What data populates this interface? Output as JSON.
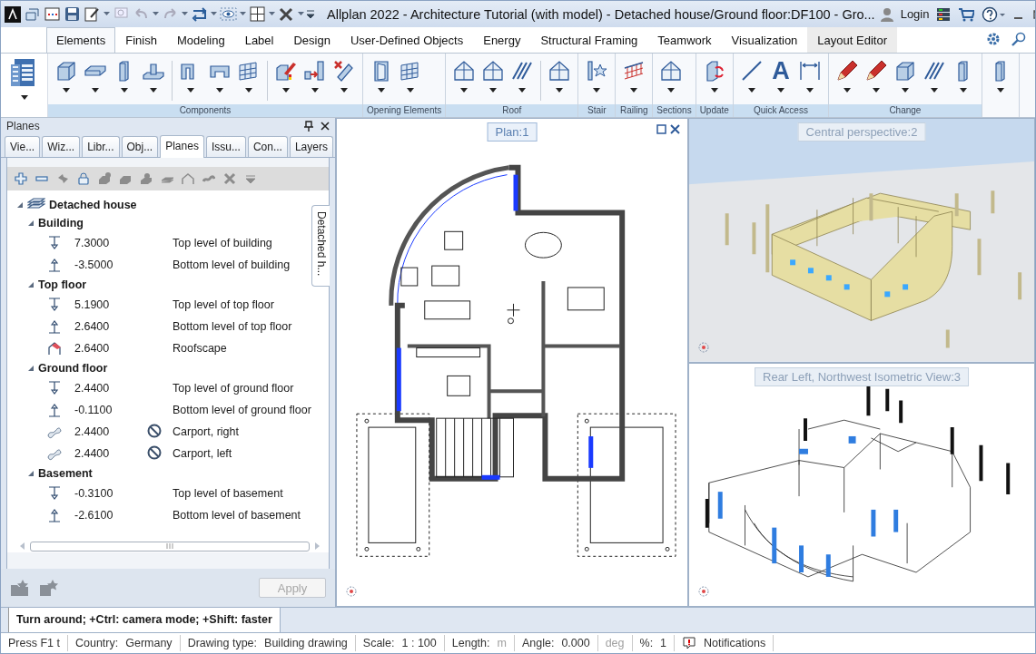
{
  "title_bar": {
    "title": "Allplan 2022 - Architecture Tutorial (with model) - Detached house/Ground floor:DF100 - Gro...",
    "login": "Login"
  },
  "ribbon": {
    "tabs": [
      {
        "label": "Elements",
        "selected": true,
        "contextual": false
      },
      {
        "label": "Finish",
        "selected": false,
        "contextual": false
      },
      {
        "label": "Modeling",
        "selected": false,
        "contextual": false
      },
      {
        "label": "Label",
        "selected": false,
        "contextual": false
      },
      {
        "label": "Design",
        "selected": false,
        "contextual": false
      },
      {
        "label": "User-Defined Objects",
        "selected": false,
        "contextual": false
      },
      {
        "label": "Energy",
        "selected": false,
        "contextual": false
      },
      {
        "label": "Structural Framing",
        "selected": false,
        "contextual": false
      },
      {
        "label": "Teamwork",
        "selected": false,
        "contextual": false
      },
      {
        "label": "Visualization",
        "selected": false,
        "contextual": false
      },
      {
        "label": "Layout Editor",
        "selected": false,
        "contextual": true
      }
    ],
    "groups": [
      {
        "label": "Components",
        "tools": [
          {
            "kind": "block"
          },
          {
            "kind": "slab"
          },
          {
            "kind": "pillar"
          },
          {
            "kind": "footing"
          },
          {
            "kind": "separator"
          },
          {
            "kind": "frame"
          },
          {
            "kind": "channel"
          },
          {
            "kind": "grid"
          },
          {
            "kind": "separator"
          },
          {
            "kind": "pencil-block"
          },
          {
            "kind": "arrow"
          },
          {
            "kind": "cross"
          }
        ]
      },
      {
        "label": "Opening Elements",
        "tools": [
          {
            "kind": "door"
          },
          {
            "kind": "grid"
          }
        ]
      },
      {
        "label": "Roof",
        "tools": [
          {
            "kind": "house"
          },
          {
            "kind": "house"
          },
          {
            "kind": "hatch"
          },
          {
            "kind": "separator"
          },
          {
            "kind": "house"
          }
        ]
      },
      {
        "label": "Stair",
        "tools": [
          {
            "kind": "star"
          }
        ]
      },
      {
        "label": "Railing",
        "tools": [
          {
            "kind": "railing"
          }
        ]
      },
      {
        "label": "Sections",
        "tools": [
          {
            "kind": "house"
          }
        ]
      },
      {
        "label": "Update",
        "tools": [
          {
            "kind": "refresh"
          }
        ]
      },
      {
        "label": "Quick Access",
        "tools": [
          {
            "kind": "line"
          },
          {
            "kind": "glyph",
            "glyph": "A"
          },
          {
            "kind": "dimension"
          }
        ]
      },
      {
        "label": "Change",
        "tools": [
          {
            "kind": "pencil"
          },
          {
            "kind": "pencil"
          },
          {
            "kind": "block"
          },
          {
            "kind": "hatch"
          },
          {
            "kind": "pillar"
          }
        ]
      },
      {
        "tools": [
          {
            "kind": "pillar"
          }
        ]
      }
    ]
  },
  "planes_panel": {
    "title": "Planes",
    "tabs": [
      {
        "label": "Vie...",
        "selected": false
      },
      {
        "label": "Wiz...",
        "selected": false
      },
      {
        "label": "Libr...",
        "selected": false
      },
      {
        "label": "Obj...",
        "selected": false
      },
      {
        "label": "Planes",
        "selected": true
      },
      {
        "label": "Issu...",
        "selected": false
      },
      {
        "label": "Con...",
        "selected": false
      },
      {
        "label": "Layers",
        "selected": false
      }
    ],
    "side_tab": "Detached h...",
    "tree": [
      {
        "kind": "structure",
        "label": "Detached house",
        "expanded": true,
        "children": [
          {
            "label": "Building",
            "expanded": true,
            "children": [
              {
                "kind": "top",
                "value": "7.3000",
                "label": "Top level of building",
                "excluded": false
              },
              {
                "kind": "bottom",
                "value": "-3.5000",
                "label": "Bottom level of building",
                "excluded": false
              }
            ]
          },
          {
            "label": "Top floor",
            "expanded": true,
            "children": [
              {
                "kind": "top",
                "value": "5.1900",
                "label": "Top level of top floor",
                "excluded": false
              },
              {
                "kind": "bottom",
                "value": "2.6400",
                "label": "Bottom level of top floor",
                "excluded": false
              },
              {
                "kind": "roof",
                "value": "2.6400",
                "label": "Roofscape",
                "excluded": false
              }
            ]
          },
          {
            "label": "Ground floor",
            "expanded": true,
            "children": [
              {
                "kind": "top",
                "value": "2.4400",
                "label": "Top level of ground floor",
                "excluded": false
              },
              {
                "kind": "bottom",
                "value": "-0.1100",
                "label": "Bottom level of ground floor",
                "excluded": false
              },
              {
                "kind": "free",
                "value": "2.4400",
                "label": "Carport, right",
                "excluded": true
              },
              {
                "kind": "free",
                "value": "2.4400",
                "label": "Carport, left",
                "excluded": true
              }
            ]
          },
          {
            "label": "Basement",
            "expanded": true,
            "children": [
              {
                "kind": "top",
                "value": "-0.3100",
                "label": "Top level of basement",
                "excluded": false
              },
              {
                "kind": "bottom",
                "value": "-2.6100",
                "label": "Bottom level of basement",
                "excluded": false
              }
            ]
          }
        ]
      }
    ],
    "apply_button": {
      "label": "Apply",
      "disabled": true
    }
  },
  "viewports": [
    {
      "kind": "plan",
      "title": "Plan:1",
      "selected": true
    },
    {
      "kind": "perspective",
      "title": "Central perspective:2",
      "selected": false
    },
    {
      "kind": "isometric",
      "title": "Rear Left, Northwest Isometric View:3",
      "selected": false
    }
  ],
  "command_hint": "Turn around; +Ctrl: camera mode; +Shift: faster",
  "status_bar": [
    {
      "kind": "text",
      "label": "Press F1 t"
    },
    {
      "kind": "field",
      "label": "Country:",
      "value": "Germany"
    },
    {
      "kind": "field",
      "label": "Drawing type:",
      "value": "Building drawing"
    },
    {
      "kind": "field",
      "label": "Scale:",
      "value": "1 : 100"
    },
    {
      "kind": "field",
      "label": "Length:",
      "unit": "m"
    },
    {
      "kind": "field",
      "label": "Angle:",
      "value": "0.000"
    },
    {
      "kind": "unit",
      "unit": "deg"
    },
    {
      "kind": "field",
      "label": "%:",
      "value": "1"
    },
    {
      "kind": "notification",
      "label": "Notifications"
    }
  ]
}
